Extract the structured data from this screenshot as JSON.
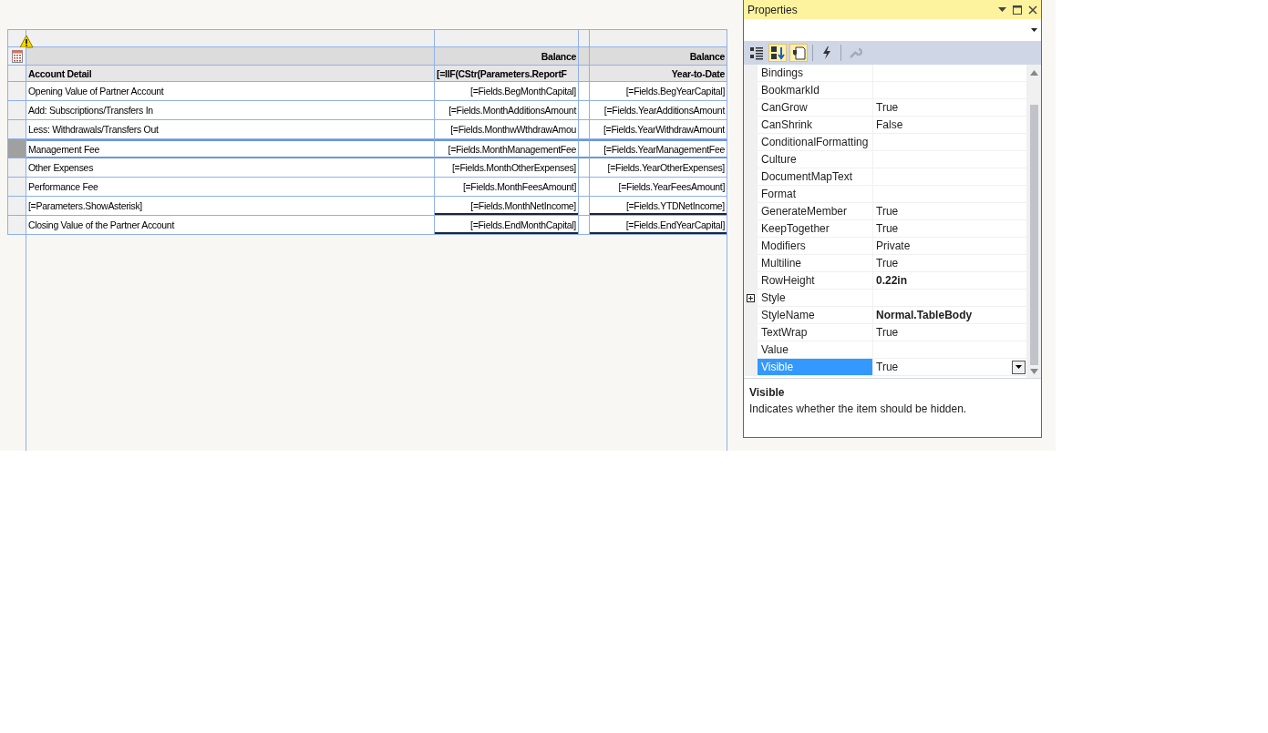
{
  "report_table": {
    "column_headers": [
      "Balance",
      "Balance"
    ],
    "header_row": [
      "Account Detail",
      "[=IIF(CStr(Parameters.ReportF",
      "Year-to-Date"
    ],
    "rows": [
      {
        "cells": [
          "Opening Value of Partner Account",
          "[=Fields.BegMonthCapital]",
          "[=Fields.BegYearCapital]"
        ],
        "selected": false,
        "kind": "detail"
      },
      {
        "cells": [
          "Add: Subscriptions/Transfers In",
          "[=Fields.MonthAdditionsAmount",
          "[=Fields.YearAdditionsAmount"
        ],
        "selected": false,
        "kind": "detail"
      },
      {
        "cells": [
          "Less: Withdrawals/Transfers Out",
          "[=Fields.MonthwWthdrawAmou",
          "[=Fields.YearWithdrawAmount"
        ],
        "selected": false,
        "kind": "detail"
      },
      {
        "cells": [
          "Management Fee",
          "[=Fields.MonthManagementFee",
          "[=Fields.YearManagementFee"
        ],
        "selected": true,
        "kind": "detail"
      },
      {
        "cells": [
          "Other Expenses",
          "[=Fields.MonthOtherExpenses]",
          "[=Fields.YearOtherExpenses]"
        ],
        "selected": false,
        "kind": "detail"
      },
      {
        "cells": [
          "Performance Fee",
          "[=Fields.MonthFeesAmount]",
          "[=Fields.YearFeesAmount]"
        ],
        "selected": false,
        "kind": "detail"
      },
      {
        "cells": [
          "[=Parameters.ShowAsterisk]",
          "[=Fields.MonthNetIncome]",
          "[=Fields.YTDNetIncome]"
        ],
        "selected": false,
        "kind": "total"
      },
      {
        "cells": [
          "Closing Value of the Partner Account",
          "[=Fields.EndMonthCapital]",
          "[=Fields.EndYearCapital]"
        ],
        "selected": false,
        "kind": "total"
      }
    ]
  },
  "properties_panel": {
    "title": "Properties",
    "toolbar": [
      {
        "kind": "categorized",
        "selected": false,
        "disabled": false
      },
      {
        "kind": "alphabetical",
        "selected": true,
        "disabled": false
      },
      {
        "kind": "property-pages",
        "selected": true,
        "disabled": false
      },
      {
        "kind": "events",
        "selected": false,
        "disabled": false
      },
      {
        "kind": "settings",
        "selected": false,
        "disabled": true
      }
    ],
    "properties": [
      {
        "name": "Bindings",
        "expandable": false,
        "selected": false
      },
      {
        "name": "BookmarkId",
        "expandable": false,
        "selected": false
      },
      {
        "name": "CanGrow",
        "value": "True",
        "bold": false,
        "expandable": false,
        "selected": false
      },
      {
        "name": "CanShrink",
        "value": "False",
        "bold": false,
        "expandable": false,
        "selected": false
      },
      {
        "name": "ConditionalFormatting",
        "expandable": false,
        "selected": false
      },
      {
        "name": "Culture",
        "expandable": false,
        "selected": false
      },
      {
        "name": "DocumentMapText",
        "expandable": false,
        "selected": false
      },
      {
        "name": "Format",
        "expandable": false,
        "selected": false
      },
      {
        "name": "GenerateMember",
        "value": "True",
        "bold": false,
        "expandable": false,
        "selected": false
      },
      {
        "name": "KeepTogether",
        "value": "True",
        "bold": false,
        "expandable": false,
        "selected": false
      },
      {
        "name": "Modifiers",
        "value": "Private",
        "bold": false,
        "expandable": false,
        "selected": false
      },
      {
        "name": "Multiline",
        "value": "True",
        "bold": false,
        "expandable": false,
        "selected": false
      },
      {
        "name": "RowHeight",
        "value": "0.22in",
        "bold": true,
        "expandable": false,
        "selected": false
      },
      {
        "name": "Style",
        "expandable": true,
        "selected": false
      },
      {
        "name": "StyleName",
        "value": "Normal.TableBody",
        "bold": true,
        "expandable": false,
        "selected": false
      },
      {
        "name": "TextWrap",
        "value": "True",
        "bold": false,
        "expandable": false,
        "selected": false
      },
      {
        "name": "Value",
        "expandable": false,
        "selected": false
      },
      {
        "name": "Visible",
        "value": "True",
        "bold": false,
        "expandable": false,
        "selected": true
      }
    ],
    "description": {
      "title": "Visible",
      "text": "Indicates whether the item should be hidden."
    }
  }
}
